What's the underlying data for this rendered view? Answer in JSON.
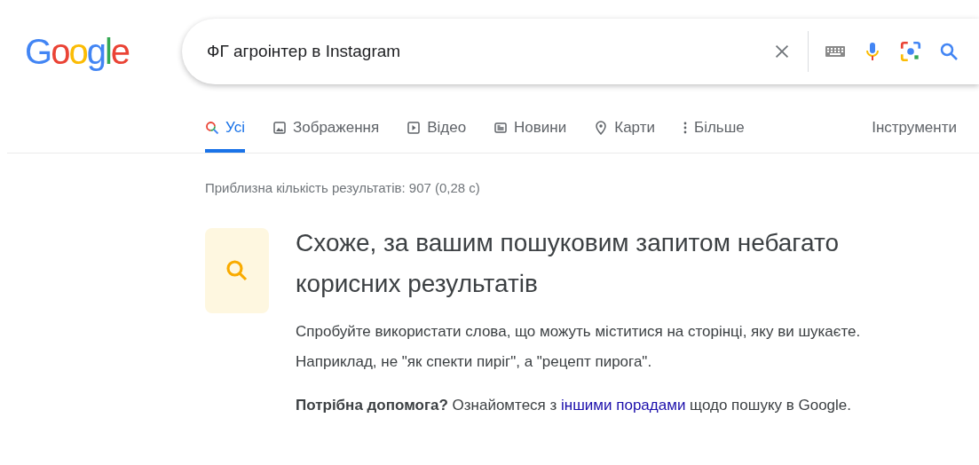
{
  "logo": "Google",
  "search": {
    "value": "ФГ агроінтер в Instagram"
  },
  "tabs": [
    {
      "label": "Усі",
      "kind": "all",
      "selected": true
    },
    {
      "label": "Зображення",
      "kind": "images",
      "selected": false
    },
    {
      "label": "Відео",
      "kind": "video",
      "selected": false
    },
    {
      "label": "Новини",
      "kind": "news",
      "selected": false
    },
    {
      "label": "Карти",
      "kind": "maps",
      "selected": false
    },
    {
      "label": "Більше",
      "kind": "more",
      "selected": false
    }
  ],
  "tools": "Інструменти",
  "result_stats": "Приблизна кількість результатів: 907 (0,28 с)",
  "notice": {
    "heading": "Схоже, за вашим пошуковим запитом небагато корисних результатів",
    "tip": "Спробуйте використати слова, що можуть міститися на сторінці, яку ви шукаєте. Наприклад, не \"як спекти пиріг\", а \"рецепт пирога\".",
    "help": {
      "bold": "Потрібна допомога?",
      "before": "Ознайомтеся з",
      "link": "іншими порадами",
      "after": "щодо пошуку в Google."
    }
  }
}
